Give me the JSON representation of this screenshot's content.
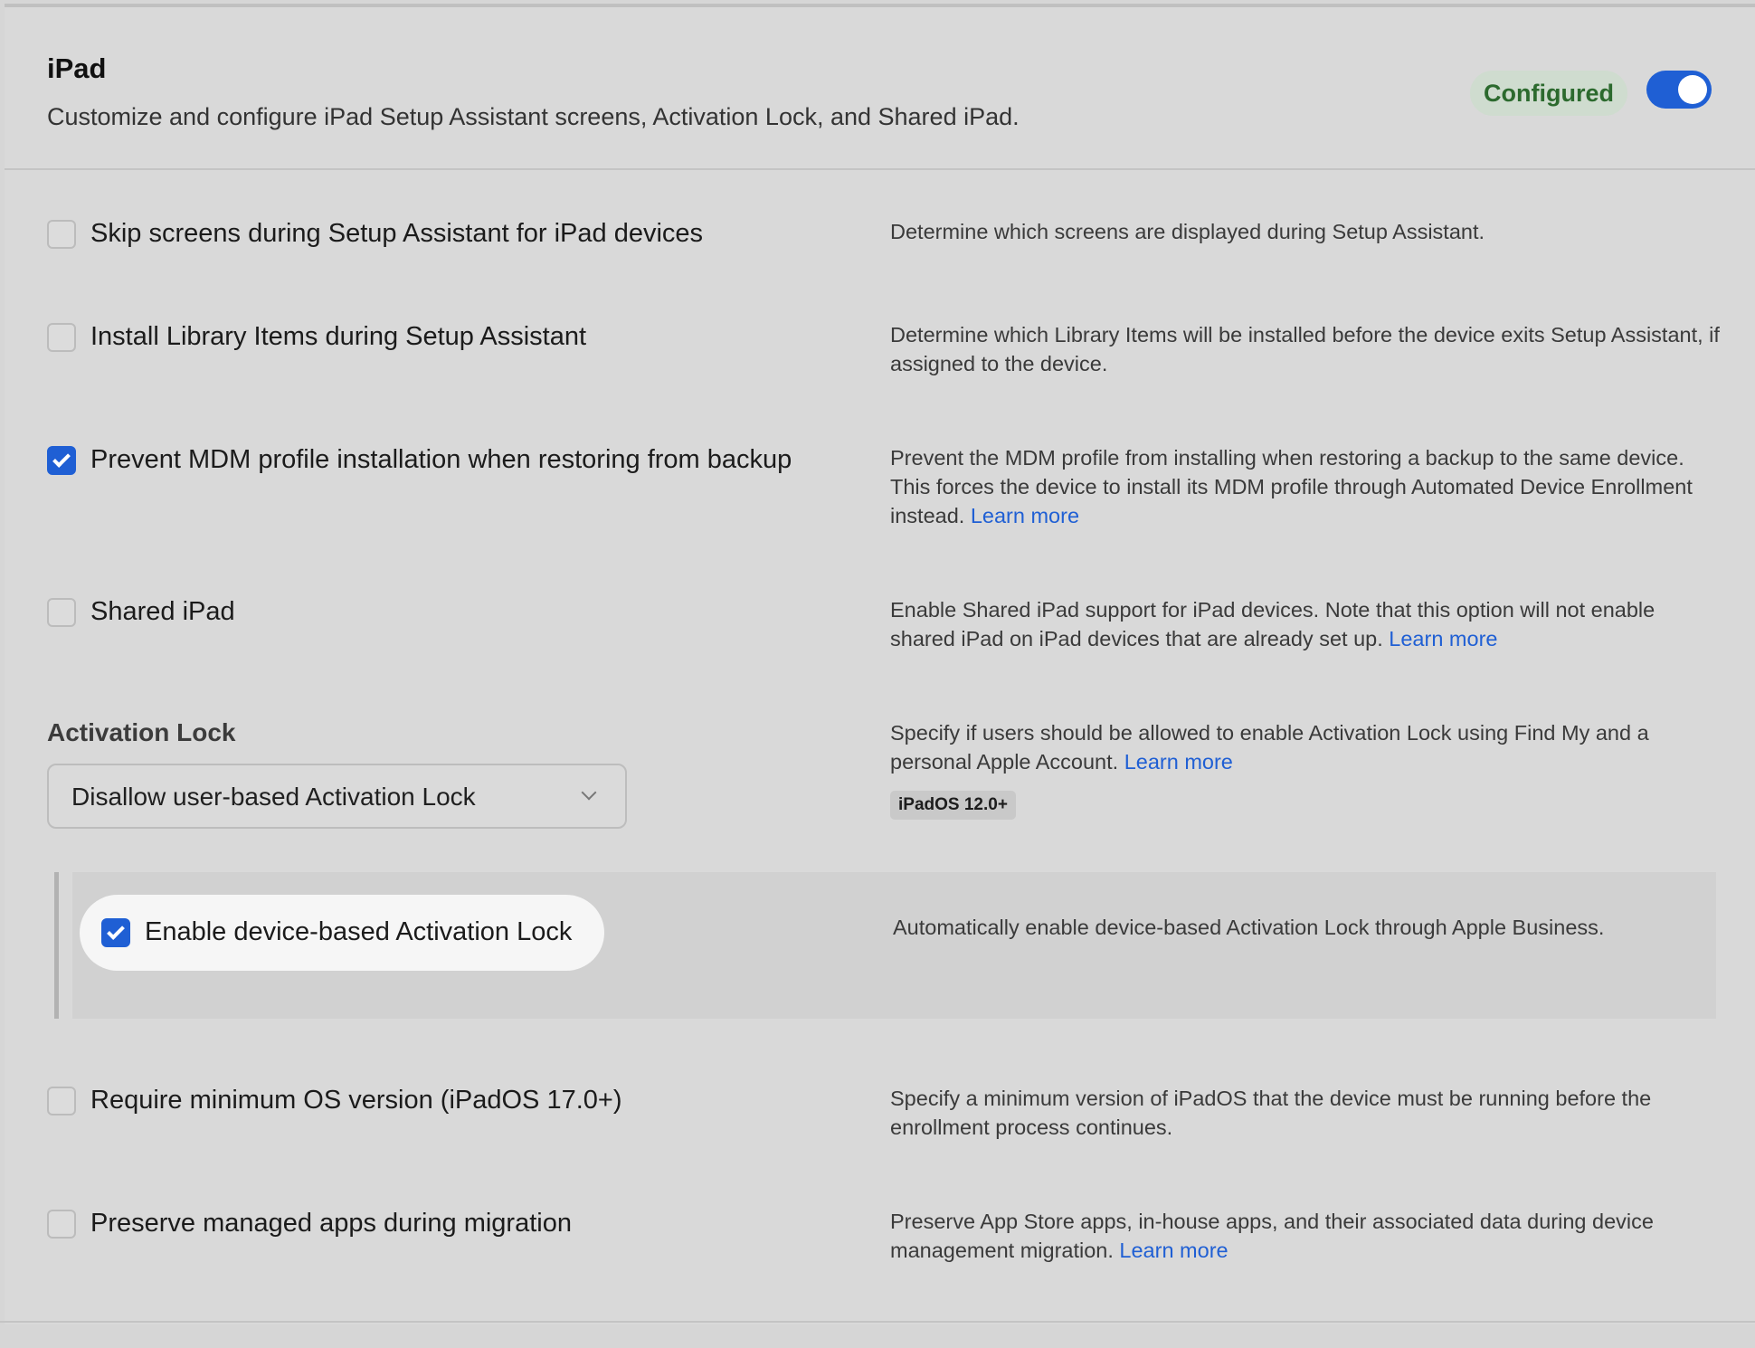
{
  "header": {
    "title": "iPad",
    "subtitle": "Customize and configure iPad Setup Assistant screens, Activation Lock, and Shared iPad.",
    "status_badge": "Configured",
    "toggle_on": true
  },
  "options": {
    "skip_screens": {
      "checked": false,
      "label": "Skip screens during Setup Assistant for iPad devices",
      "description": "Determine which screens are displayed during Setup Assistant."
    },
    "install_library": {
      "checked": false,
      "label": "Install Library Items during Setup Assistant",
      "description": "Determine which Library Items will be installed before the device exits Setup Assistant, if assigned to the device."
    },
    "prevent_mdm": {
      "checked": true,
      "label": "Prevent MDM profile installation when restoring from backup",
      "description": "Prevent the MDM profile from installing when restoring a backup to the same device. This forces the device to install its MDM profile through Automated Device Enrollment instead.",
      "link": "Learn more"
    },
    "shared_ipad": {
      "checked": false,
      "label": "Shared iPad",
      "description": "Enable Shared iPad support for iPad devices. Note that this option will not enable shared iPad on iPad devices that are already set up.",
      "link": "Learn more"
    },
    "activation_lock": {
      "section_title": "Activation Lock",
      "selected": "Disallow user-based Activation Lock",
      "description": "Specify if users should be allowed to enable Activation Lock using Find My and a personal Apple Account.",
      "link": "Learn more",
      "os_badge": "iPadOS 12.0+"
    },
    "device_activation_lock": {
      "checked": true,
      "label": "Enable device-based Activation Lock",
      "description": "Automatically enable device-based Activation Lock through Apple Business."
    },
    "min_os": {
      "checked": false,
      "label": "Require minimum OS version (iPadOS 17.0+)",
      "description": "Specify a minimum version of iPadOS that the device must be running before the enrollment process continues."
    },
    "preserve_apps": {
      "checked": false,
      "label": "Preserve managed apps during migration",
      "description": "Preserve App Store apps, in-house apps, and their associated data during device management migration.",
      "link": "Learn more"
    }
  },
  "colors": {
    "accent": "#1f5fd4",
    "badge_text": "#2c6a2e",
    "badge_bg": "#cfdccf"
  }
}
